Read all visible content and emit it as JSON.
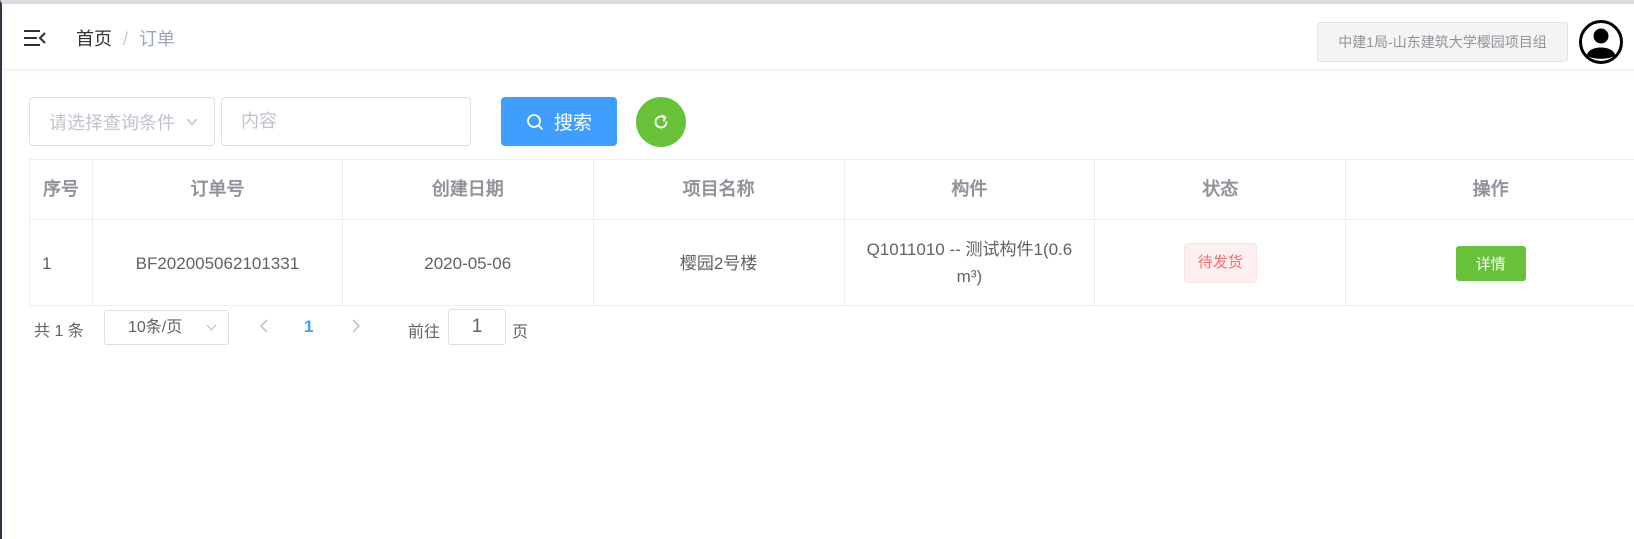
{
  "header": {
    "breadcrumb": {
      "home": "首页",
      "separator": "/",
      "current": "订单"
    },
    "org_name": "中建1局-山东建筑大学樱园项目组"
  },
  "search": {
    "select_placeholder": "请选择查询条件",
    "input_placeholder": "内容",
    "search_label": "搜索"
  },
  "table": {
    "columns": [
      "序号",
      "订单号",
      "创建日期",
      "项目名称",
      "构件",
      "状态",
      "操作"
    ],
    "rows": [
      {
        "index": "1",
        "order_no": "BF202005062101331",
        "created": "2020-05-06",
        "project": "樱园2号楼",
        "component": "Q1011010 -- 测试构件1(0.6 m³)",
        "status": "待发货",
        "action": "详情"
      }
    ]
  },
  "pagination": {
    "total_text": "共 1 条",
    "page_size": "10条/页",
    "current_page": "1",
    "goto_prefix": "前往",
    "goto_value": "1",
    "goto_suffix": "页"
  },
  "colors": {
    "primary": "#409eff",
    "success": "#67c23a",
    "danger": "#f56c6c"
  },
  "icons": [
    "hamburger-icon",
    "avatar-icon",
    "chevron-down-icon",
    "search-icon",
    "refresh-icon",
    "chevron-left-icon",
    "chevron-right-icon"
  ]
}
